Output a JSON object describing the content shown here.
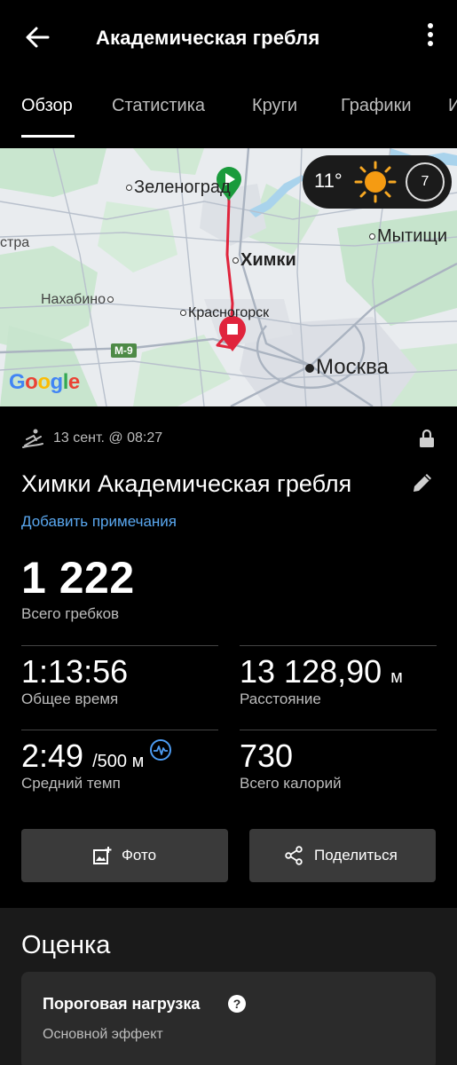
{
  "header": {
    "title": "Академическая гребля"
  },
  "tabs": [
    {
      "label": "Обзор",
      "active": true
    },
    {
      "label": "Статистика",
      "active": false
    },
    {
      "label": "Круги",
      "active": false
    },
    {
      "label": "Графики",
      "active": false
    },
    {
      "label": "И",
      "active": false
    }
  ],
  "map": {
    "weather": {
      "temperature": "11°",
      "uv_index": "7"
    },
    "labels": {
      "zelenograd": "Зеленоград",
      "mytishchi": "Мытищи",
      "khimki": "Химки",
      "nakhabino": "Нахабино",
      "krasnogorsk": "Красногорск",
      "moscow": "Москва",
      "stra": "стра",
      "road": "M-9"
    },
    "attribution": "Google",
    "route_color": "#e0243c",
    "start_color": "#1a9b3c"
  },
  "activity": {
    "date": "13 сент. @ 08:27",
    "title": "Химки Академическая гребля",
    "add_notes": "Добавить примечания",
    "total_strokes": {
      "value": "1 222",
      "label": "Всего гребков"
    },
    "stats": [
      {
        "value": "1:13:56",
        "unit": "",
        "label": "Общее время"
      },
      {
        "value": "13 128,90",
        "unit": "м",
        "label": "Расстояние"
      },
      {
        "value": "2:49",
        "unit": "/500 м",
        "label": "Средний темп"
      },
      {
        "value": "730",
        "unit": "",
        "label": "Всего калорий"
      }
    ]
  },
  "buttons": {
    "photo": "Фото",
    "share": "Поделиться"
  },
  "assessment": {
    "heading": "Оценка",
    "card_title": "Пороговая нагрузка",
    "card_subtitle": "Основной эффект",
    "help": "?"
  },
  "colors": {
    "link": "#5aa8f0",
    "accent_icon": "#4d9cf2",
    "background": "#000000",
    "button": "#3a3a3a"
  }
}
